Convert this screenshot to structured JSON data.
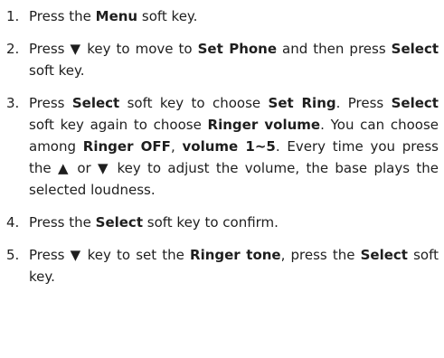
{
  "steps": [
    {
      "num": "1.",
      "segments": [
        {
          "t": "Press the ",
          "b": false
        },
        {
          "t": "Menu",
          "b": true
        },
        {
          "t": " soft key.",
          "b": false
        }
      ]
    },
    {
      "num": "2.",
      "segments": [
        {
          "t": "Press ▼ key to move to ",
          "b": false
        },
        {
          "t": "Set Phone",
          "b": true
        },
        {
          "t": " and then press ",
          "b": false
        },
        {
          "t": "Select",
          "b": true
        },
        {
          "t": " soft key.",
          "b": false
        }
      ]
    },
    {
      "num": "3.",
      "segments": [
        {
          "t": "Press ",
          "b": false
        },
        {
          "t": "Select",
          "b": true
        },
        {
          "t": " soft key to choose ",
          "b": false
        },
        {
          "t": "Set Ring",
          "b": true
        },
        {
          "t": ". Press ",
          "b": false
        },
        {
          "t": "Select",
          "b": true
        },
        {
          "t": " soft key again to choose ",
          "b": false
        },
        {
          "t": "Ringer volume",
          "b": true
        },
        {
          "t": ". You can choose among ",
          "b": false
        },
        {
          "t": "Ringer OFF",
          "b": true
        },
        {
          "t": ", ",
          "b": false
        },
        {
          "t": "volume 1~5",
          "b": true
        },
        {
          "t": ". Every time you press the ▲ or ▼ key to adjust the volume, the base plays the selected loudness.",
          "b": false
        }
      ]
    },
    {
      "num": "4.",
      "segments": [
        {
          "t": "Press the ",
          "b": false
        },
        {
          "t": "Select",
          "b": true
        },
        {
          "t": " soft key to confirm.",
          "b": false
        }
      ]
    },
    {
      "num": "5.",
      "segments": [
        {
          "t": "Press ▼ key to set the ",
          "b": false
        },
        {
          "t": "Ringer tone",
          "b": true
        },
        {
          "t": ", press the ",
          "b": false
        },
        {
          "t": "Select",
          "b": true
        },
        {
          "t": " soft key.",
          "b": false
        }
      ]
    }
  ]
}
